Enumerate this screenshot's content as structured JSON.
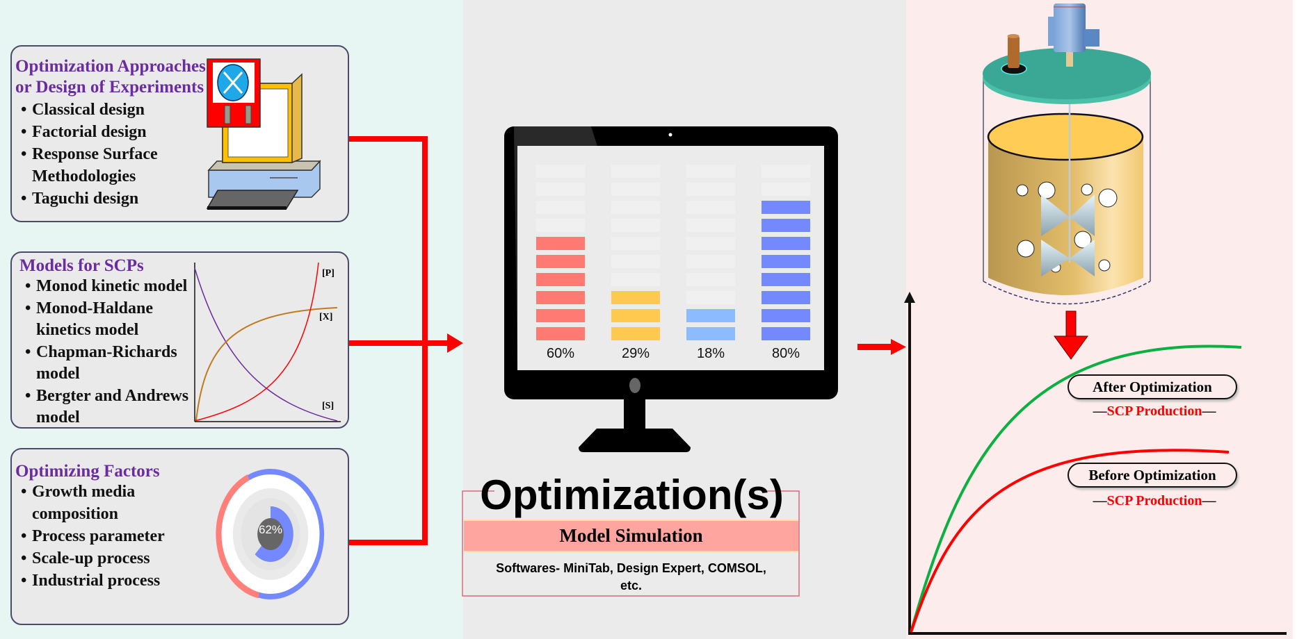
{
  "left": {
    "design": {
      "title_line1": "Optimization Approaches",
      "title_line2": "or Design of Experiments",
      "items": [
        "Classical design",
        "Factorial design",
        "Response Surface",
        "Methodologies",
        "Taguchi design"
      ],
      "icon": "computer-floppy-icon"
    },
    "models": {
      "title": "Models for SCPs",
      "items": [
        "Monod kinetic model",
        "Monod-Haldane",
        "kinetics model",
        "Chapman-Richards",
        "model",
        "Bergter and Andrews",
        "model"
      ],
      "chart_labels": {
        "p": "[P]",
        "x": "[X]",
        "s": "[S]"
      }
    },
    "factors": {
      "title": "Optimizing Factors",
      "items": [
        "Growth media",
        "composition",
        "Process parameter",
        "Scale-up process",
        "Industrial process"
      ],
      "donut_label": "62%",
      "donut_value": 62
    }
  },
  "middle": {
    "monitor_bars": [
      {
        "label": "60%",
        "filled_segments": 6,
        "color": "#ff7a72"
      },
      {
        "label": "29%",
        "filled_segments": 3,
        "color": "#ffc84f"
      },
      {
        "label": "18%",
        "filled_segments": 2,
        "color": "#8cbcff"
      },
      {
        "label": "80%",
        "filled_segments": 8,
        "color": "#7589ff"
      }
    ],
    "segments_per_bar": 10,
    "title": "Optimization(s)",
    "band": "Model Simulation",
    "software_line1": "Softwares- MiniTab, Design Expert, COMSOL,",
    "software_line2": "etc."
  },
  "right": {
    "reactor_icon": "bioreactor-icon",
    "after": {
      "label": "After Optimization",
      "sub": "SCP Production",
      "color": "#0ab040"
    },
    "before": {
      "label": "Before Optimization",
      "sub": "SCP Production",
      "color": "#ff0000"
    },
    "dash": "—"
  },
  "colors": {
    "arrow": "#ff0000",
    "title": "#6a2c9e"
  }
}
